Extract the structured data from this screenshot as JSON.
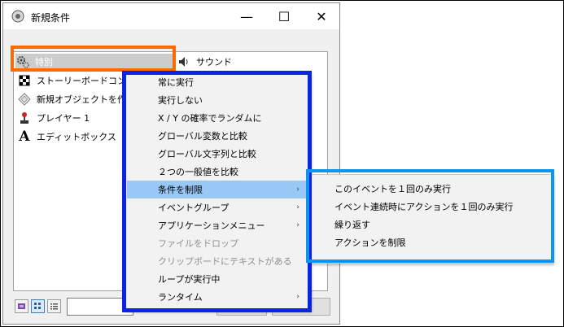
{
  "window": {
    "title": "新規条件",
    "minimize_glyph": "—",
    "maximize_glyph": "☐",
    "close_glyph": "✕"
  },
  "objects": {
    "items": [
      {
        "label": "特別",
        "icon": "gears-icon"
      },
      {
        "label": "ストーリーボードコントロ",
        "icon": "checkered-flag-icon"
      },
      {
        "label": "新規オブジェクトを作成",
        "icon": "diamond-outline-icon"
      },
      {
        "label": "プレイヤー 1",
        "icon": "joystick-icon"
      },
      {
        "label": "エディットボックス",
        "icon": "letter-a-icon"
      },
      {
        "label": "サウンド",
        "icon": "speaker-icon"
      }
    ]
  },
  "bottom": {
    "button1_label": "",
    "button2_label": ""
  },
  "context_menu": {
    "items": [
      {
        "label": "常に実行",
        "submenu": false,
        "disabled": false
      },
      {
        "label": "実行しない",
        "submenu": false,
        "disabled": false
      },
      {
        "label": "X / Y の確率でランダムに",
        "submenu": false,
        "disabled": false
      },
      {
        "label": "グローバル変数と比較",
        "submenu": false,
        "disabled": false
      },
      {
        "label": "グローバル文字列と比較",
        "submenu": false,
        "disabled": false
      },
      {
        "label": "２つの一般値を比較",
        "submenu": false,
        "disabled": false
      },
      {
        "label": "条件を制限",
        "submenu": true,
        "disabled": false,
        "highlighted": true
      },
      {
        "label": "イベントグループ",
        "submenu": true,
        "disabled": false
      },
      {
        "label": "アプリケーションメニュー",
        "submenu": true,
        "disabled": false
      },
      {
        "label": "ファイルをドロップ",
        "submenu": false,
        "disabled": true
      },
      {
        "label": "クリップボードにテキストがある",
        "submenu": false,
        "disabled": true
      },
      {
        "label": "ループが実行中",
        "submenu": false,
        "disabled": false
      },
      {
        "label": "ランタイム",
        "submenu": true,
        "disabled": false
      }
    ],
    "submenu_arrow": "›"
  },
  "submenu": {
    "items": [
      {
        "label": "このイベントを１回のみ実行"
      },
      {
        "label": "イベント連続時にアクションを１回のみ実行"
      },
      {
        "label": "繰り返す"
      },
      {
        "label": "アクションを制限"
      }
    ]
  },
  "colors": {
    "highlight_orange": "#ff6a00",
    "highlight_dark_blue": "#0a23e6",
    "highlight_light_blue": "#0a96f0",
    "menu_hover": "#99c8f6"
  }
}
